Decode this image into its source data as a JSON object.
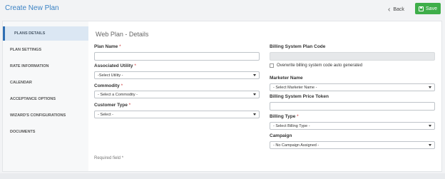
{
  "header": {
    "title": "Create New Plan",
    "back_label": "Back",
    "save_label": "Save",
    "save_color": "#3fae4a",
    "title_color": "#3b82c4"
  },
  "sidebar": {
    "items": [
      {
        "label": "PLANS DETAILS",
        "active": true
      },
      {
        "label": "PLAN SETTINGS",
        "active": false
      },
      {
        "label": "RATE INFORMATION",
        "active": false
      },
      {
        "label": "CALENDAR",
        "active": false
      },
      {
        "label": "ACCEPTANCE OPTIONS",
        "active": false
      },
      {
        "label": "WIZARD'S CONFIGURATIONS",
        "active": false
      },
      {
        "label": "DOCUMENTS",
        "active": false
      }
    ]
  },
  "form": {
    "section_title": "Web Plan - Details",
    "plan_name": {
      "label": "Plan Name",
      "required_mark": "*",
      "value": ""
    },
    "associated_utility": {
      "label": "Associated Utility",
      "required_mark": "*",
      "selected": "-Select Utility -"
    },
    "commodity": {
      "label": "Commodity",
      "required_mark": "*",
      "selected": "- Select a Commodity -"
    },
    "customer_type": {
      "label": "Customer Type",
      "required_mark": "*",
      "selected": "- Select -"
    },
    "billing_system_plan_code": {
      "label": "Billing System Plan Code",
      "value": ""
    },
    "overwrite_checkbox": {
      "label": "Overwrite billing system code auto generated",
      "checked": false
    },
    "marketer_name": {
      "label": "Marketer Name",
      "selected": "- Select Marketer Name -"
    },
    "billing_price_token": {
      "label": "Billing System Price Token",
      "value": ""
    },
    "billing_type": {
      "label": "Billing Type",
      "required_mark": "*",
      "selected": "- Select Billing Type -"
    },
    "campaign": {
      "label": "Campaign",
      "selected": "- No Campaign Assigned -"
    },
    "required_note": "Required field *"
  }
}
